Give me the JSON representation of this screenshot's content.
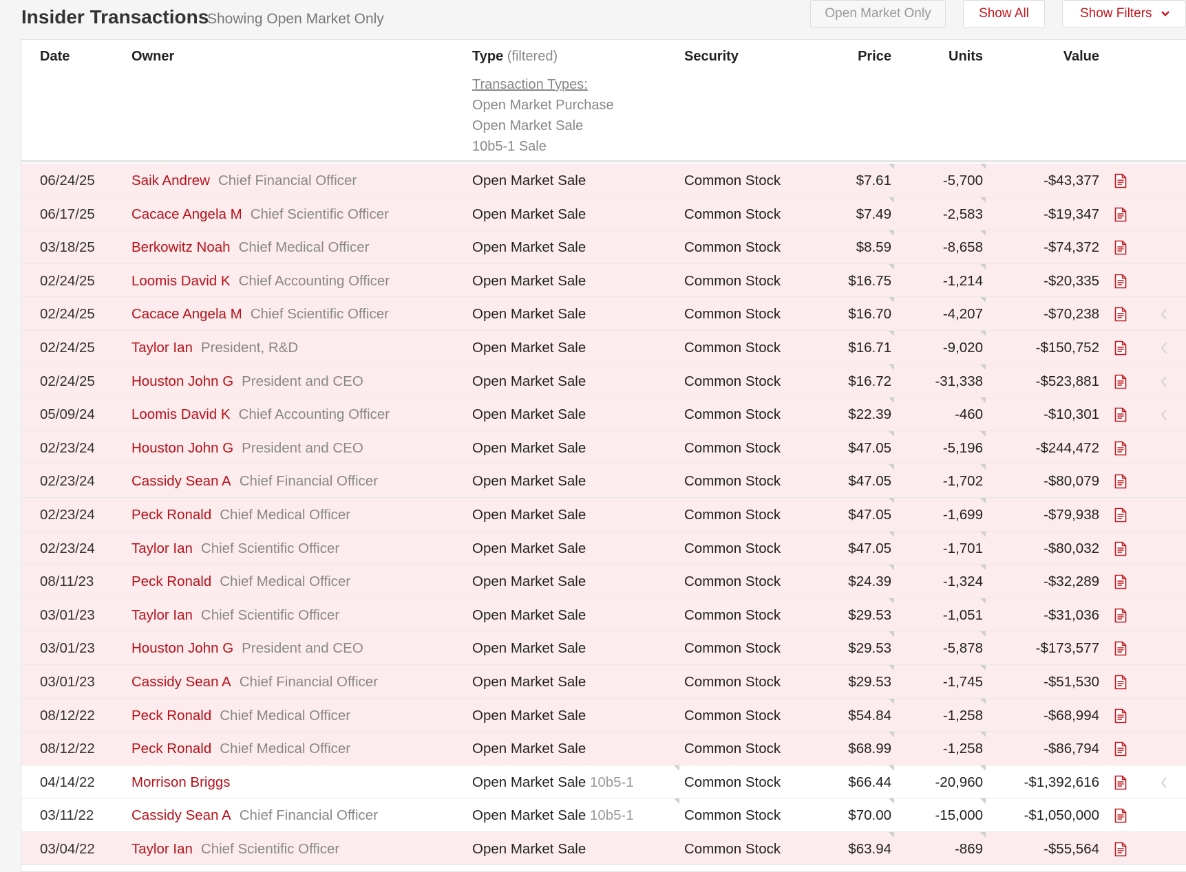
{
  "header": {
    "title": "Insider Transactions",
    "subtitle": "Showing Open Market Only",
    "buttons": {
      "open_market_only": "Open Market Only",
      "show_all": "Show All",
      "show_filters": "Show Filters"
    }
  },
  "table": {
    "columns": {
      "date": "Date",
      "owner": "Owner",
      "type": "Type",
      "type_note": "(filtered)",
      "security": "Security",
      "price": "Price",
      "units": "Units",
      "value": "Value"
    },
    "transaction_types": {
      "heading": "Transaction Types:",
      "items": [
        "Open Market Purchase",
        "Open Market Sale",
        "10b5-1 Sale"
      ]
    },
    "rows": [
      {
        "date": "06/24/25",
        "name": "Saik Andrew",
        "title": "Chief Financial Officer",
        "type": "Open Market Sale",
        "type_suffix": "",
        "security": "Common Stock",
        "price": "$7.61",
        "units": "-5,700",
        "value": "-$43,377",
        "style": "sale",
        "back": false
      },
      {
        "date": "06/17/25",
        "name": "Cacace Angela M",
        "title": "Chief Scientific Officer",
        "type": "Open Market Sale",
        "type_suffix": "",
        "security": "Common Stock",
        "price": "$7.49",
        "units": "-2,583",
        "value": "-$19,347",
        "style": "sale",
        "back": false
      },
      {
        "date": "03/18/25",
        "name": "Berkowitz Noah",
        "title": "Chief Medical Officer",
        "type": "Open Market Sale",
        "type_suffix": "",
        "security": "Common Stock",
        "price": "$8.59",
        "units": "-8,658",
        "value": "-$74,372",
        "style": "sale",
        "back": false
      },
      {
        "date": "02/24/25",
        "name": "Loomis David K",
        "title": "Chief Accounting Officer",
        "type": "Open Market Sale",
        "type_suffix": "",
        "security": "Common Stock",
        "price": "$16.75",
        "units": "-1,214",
        "value": "-$20,335",
        "style": "sale",
        "back": false
      },
      {
        "date": "02/24/25",
        "name": "Cacace Angela M",
        "title": "Chief Scientific Officer",
        "type": "Open Market Sale",
        "type_suffix": "",
        "security": "Common Stock",
        "price": "$16.70",
        "units": "-4,207",
        "value": "-$70,238",
        "style": "sale",
        "back": true
      },
      {
        "date": "02/24/25",
        "name": "Taylor Ian",
        "title": "President, R&D",
        "type": "Open Market Sale",
        "type_suffix": "",
        "security": "Common Stock",
        "price": "$16.71",
        "units": "-9,020",
        "value": "-$150,752",
        "style": "sale",
        "back": true
      },
      {
        "date": "02/24/25",
        "name": "Houston John G",
        "title": "President and CEO",
        "type": "Open Market Sale",
        "type_suffix": "",
        "security": "Common Stock",
        "price": "$16.72",
        "units": "-31,338",
        "value": "-$523,881",
        "style": "sale",
        "back": true
      },
      {
        "date": "05/09/24",
        "name": "Loomis David K",
        "title": "Chief Accounting Officer",
        "type": "Open Market Sale",
        "type_suffix": "",
        "security": "Common Stock",
        "price": "$22.39",
        "units": "-460",
        "value": "-$10,301",
        "style": "sale",
        "back": true
      },
      {
        "date": "02/23/24",
        "name": "Houston John G",
        "title": "President and CEO",
        "type": "Open Market Sale",
        "type_suffix": "",
        "security": "Common Stock",
        "price": "$47.05",
        "units": "-5,196",
        "value": "-$244,472",
        "style": "sale",
        "back": false
      },
      {
        "date": "02/23/24",
        "name": "Cassidy Sean A",
        "title": "Chief Financial Officer",
        "type": "Open Market Sale",
        "type_suffix": "",
        "security": "Common Stock",
        "price": "$47.05",
        "units": "-1,702",
        "value": "-$80,079",
        "style": "sale",
        "back": false
      },
      {
        "date": "02/23/24",
        "name": "Peck Ronald",
        "title": "Chief Medical Officer",
        "type": "Open Market Sale",
        "type_suffix": "",
        "security": "Common Stock",
        "price": "$47.05",
        "units": "-1,699",
        "value": "-$79,938",
        "style": "sale",
        "back": false
      },
      {
        "date": "02/23/24",
        "name": "Taylor Ian",
        "title": "Chief Scientific Officer",
        "type": "Open Market Sale",
        "type_suffix": "",
        "security": "Common Stock",
        "price": "$47.05",
        "units": "-1,701",
        "value": "-$80,032",
        "style": "sale",
        "back": false
      },
      {
        "date": "08/11/23",
        "name": "Peck Ronald",
        "title": "Chief Medical Officer",
        "type": "Open Market Sale",
        "type_suffix": "",
        "security": "Common Stock",
        "price": "$24.39",
        "units": "-1,324",
        "value": "-$32,289",
        "style": "sale",
        "back": false
      },
      {
        "date": "03/01/23",
        "name": "Taylor Ian",
        "title": "Chief Scientific Officer",
        "type": "Open Market Sale",
        "type_suffix": "",
        "security": "Common Stock",
        "price": "$29.53",
        "units": "-1,051",
        "value": "-$31,036",
        "style": "sale",
        "back": false
      },
      {
        "date": "03/01/23",
        "name": "Houston John G",
        "title": "President and CEO",
        "type": "Open Market Sale",
        "type_suffix": "",
        "security": "Common Stock",
        "price": "$29.53",
        "units": "-5,878",
        "value": "-$173,577",
        "style": "sale",
        "back": false
      },
      {
        "date": "03/01/23",
        "name": "Cassidy Sean A",
        "title": "Chief Financial Officer",
        "type": "Open Market Sale",
        "type_suffix": "",
        "security": "Common Stock",
        "price": "$29.53",
        "units": "-1,745",
        "value": "-$51,530",
        "style": "sale",
        "back": false
      },
      {
        "date": "08/12/22",
        "name": "Peck Ronald",
        "title": "Chief Medical Officer",
        "type": "Open Market Sale",
        "type_suffix": "",
        "security": "Common Stock",
        "price": "$54.84",
        "units": "-1,258",
        "value": "-$68,994",
        "style": "sale",
        "back": false
      },
      {
        "date": "08/12/22",
        "name": "Peck Ronald",
        "title": "Chief Medical Officer",
        "type": "Open Market Sale",
        "type_suffix": "",
        "security": "Common Stock",
        "price": "$68.99",
        "units": "-1,258",
        "value": "-$86,794",
        "style": "sale",
        "back": false
      },
      {
        "date": "04/14/22",
        "name": "Morrison Briggs",
        "title": "",
        "type": "Open Market Sale",
        "type_suffix": "10b5-1",
        "security": "Common Stock",
        "price": "$66.44",
        "units": "-20,960",
        "value": "-$1,392,616",
        "style": "plain",
        "back": true
      },
      {
        "date": "03/11/22",
        "name": "Cassidy Sean A",
        "title": "Chief Financial Officer",
        "type": "Open Market Sale",
        "type_suffix": "10b5-1",
        "security": "Common Stock",
        "price": "$70.00",
        "units": "-15,000",
        "value": "-$1,050,000",
        "style": "plain",
        "back": false
      },
      {
        "date": "03/04/22",
        "name": "Taylor Ian",
        "title": "Chief Scientific Officer",
        "type": "Open Market Sale",
        "type_suffix": "",
        "security": "Common Stock",
        "price": "$63.94",
        "units": "-869",
        "value": "-$55,564",
        "style": "sale",
        "back": false
      }
    ]
  },
  "colors": {
    "accent": "#c0161d",
    "sale_row_bg": "#fdeced",
    "muted_text": "#888888"
  },
  "icons": {
    "document": "document-icon",
    "chevron": "chevron-down-icon",
    "back": "chevron-left-icon"
  }
}
